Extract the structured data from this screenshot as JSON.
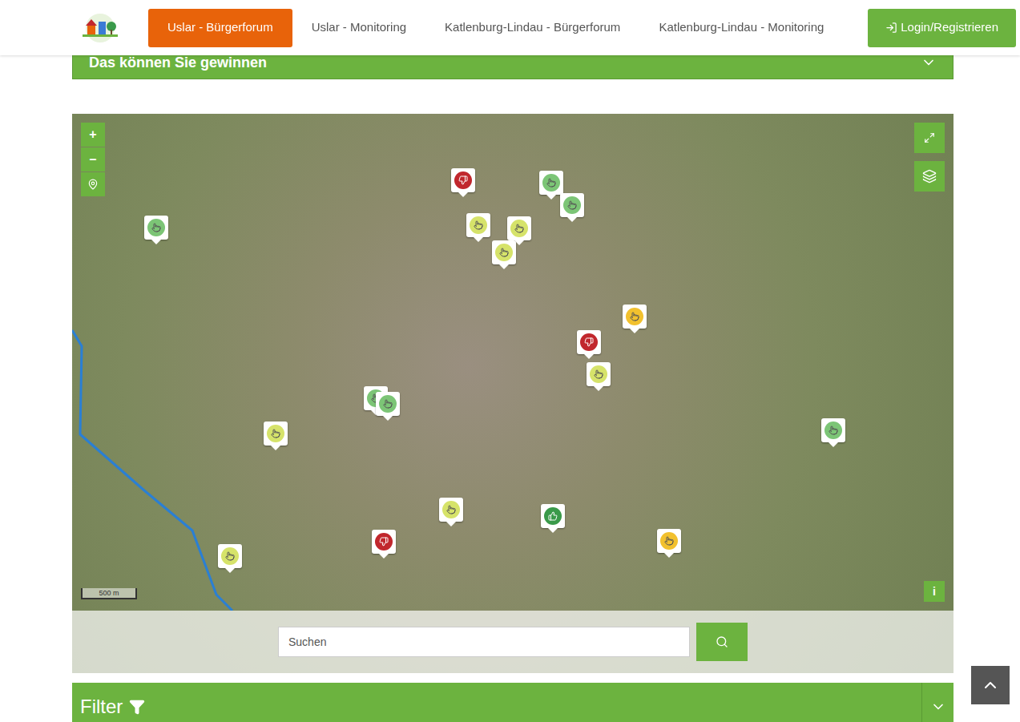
{
  "nav": {
    "items": [
      {
        "label": "Uslar - Bürgerforum",
        "selected": true
      },
      {
        "label": "Uslar - Monitoring",
        "selected": false
      },
      {
        "label": "Katlenburg-Lindau - Bürgerforum",
        "selected": false
      },
      {
        "label": "Katlenburg-Lindau - Monitoring",
        "selected": false
      }
    ],
    "login": "Login/Registrieren"
  },
  "accordion": {
    "title": "Das können Sie gewinnen",
    "expanded": false
  },
  "map": {
    "zoom_in": "+",
    "zoom_out": "–",
    "scale": "500 m",
    "info": "i",
    "pins": [
      {
        "kind": "neutral",
        "color": "#7cc576"
      },
      {
        "kind": "dislike",
        "color": "#c1272d"
      },
      {
        "kind": "neutral",
        "color": "#d6e36a"
      },
      {
        "kind": "neutral",
        "color": "#d6e36a"
      },
      {
        "kind": "neutral",
        "color": "#d6e36a"
      },
      {
        "kind": "neutral",
        "color": "#7cc576"
      },
      {
        "kind": "neutral",
        "color": "#7cc576"
      },
      {
        "kind": "neutral",
        "color": "#f2c12e"
      },
      {
        "kind": "dislike",
        "color": "#c1272d"
      },
      {
        "kind": "neutral",
        "color": "#d6e36a"
      },
      {
        "kind": "neutral",
        "color": "#7cc576"
      },
      {
        "kind": "neutral",
        "color": "#7cc576"
      },
      {
        "kind": "neutral",
        "color": "#d6e36a"
      },
      {
        "kind": "neutral",
        "color": "#7cc576"
      },
      {
        "kind": "neutral",
        "color": "#d6e36a"
      },
      {
        "kind": "like",
        "color": "#3a9a4a"
      },
      {
        "kind": "dislike",
        "color": "#c1272d"
      },
      {
        "kind": "neutral",
        "color": "#f2c12e"
      },
      {
        "kind": "neutral",
        "color": "#d6e36a"
      }
    ]
  },
  "search": {
    "placeholder": "Suchen"
  },
  "filter": {
    "title": "Filter",
    "expanded": false
  }
}
